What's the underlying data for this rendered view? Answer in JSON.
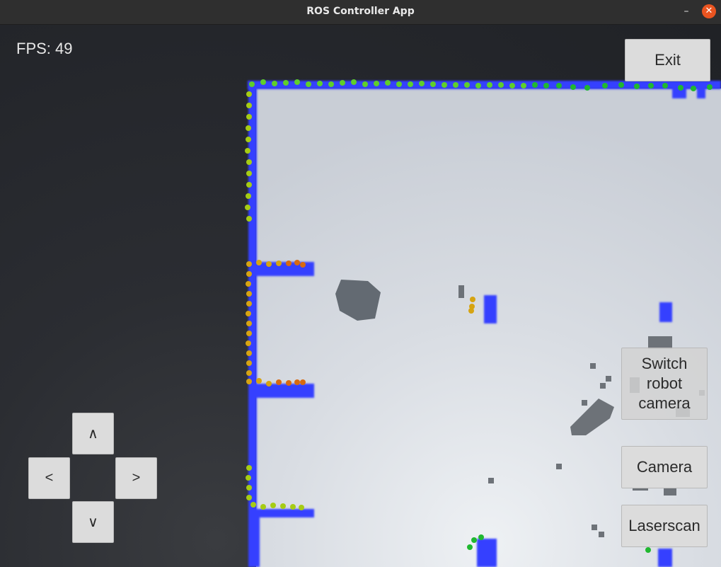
{
  "window": {
    "title": "ROS Controller App",
    "minimize_icon": "minimize-icon",
    "close_icon": "close-icon",
    "close_color": "#e95420"
  },
  "hud": {
    "fps": "FPS: 49"
  },
  "buttons": {
    "exit": "Exit",
    "switch_camera": [
      "Switch",
      "robot",
      "camera"
    ],
    "camera": "Camera",
    "laserscan": "Laserscan"
  },
  "dpad": {
    "up": "∧",
    "left": "<",
    "right": ">",
    "down": "∨"
  },
  "colors": {
    "occupancy_wall": "#2f3dff",
    "free_space": "#d6dbe2",
    "laser_near": "#d4a000",
    "laser_far": "#28b428"
  }
}
